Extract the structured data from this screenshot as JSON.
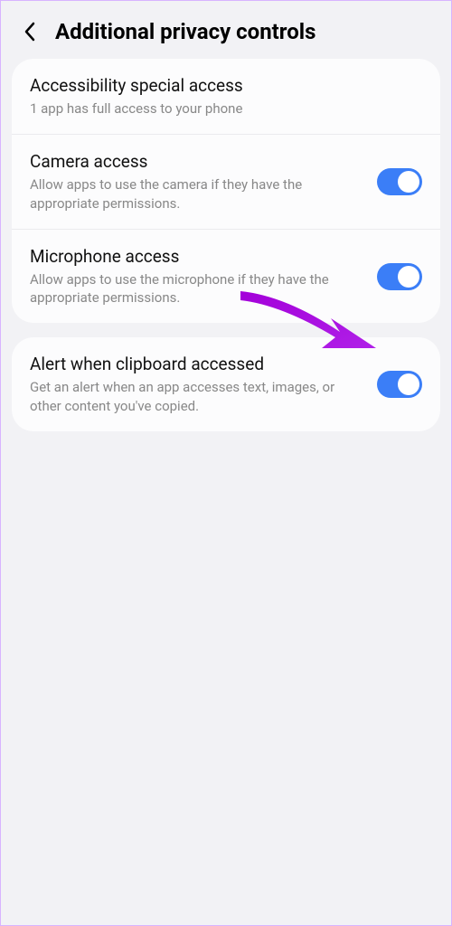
{
  "header": {
    "title": "Additional privacy controls"
  },
  "sections": [
    {
      "items": [
        {
          "title": "Accessibility special access",
          "description": "1 app has full access to your phone",
          "hasToggle": false
        },
        {
          "title": "Camera access",
          "description": "Allow apps to use the camera if they have the appropriate permissions.",
          "hasToggle": true,
          "toggleOn": true
        },
        {
          "title": "Microphone access",
          "description": "Allow apps to use the microphone if they have the appropriate permissions.",
          "hasToggle": true,
          "toggleOn": true
        }
      ]
    },
    {
      "items": [
        {
          "title": "Alert when clipboard accessed",
          "description": "Get an alert when an app accesses text, images, or other content you've copied.",
          "hasToggle": true,
          "toggleOn": true
        }
      ]
    }
  ],
  "annotation": {
    "color": "#a300d9"
  }
}
